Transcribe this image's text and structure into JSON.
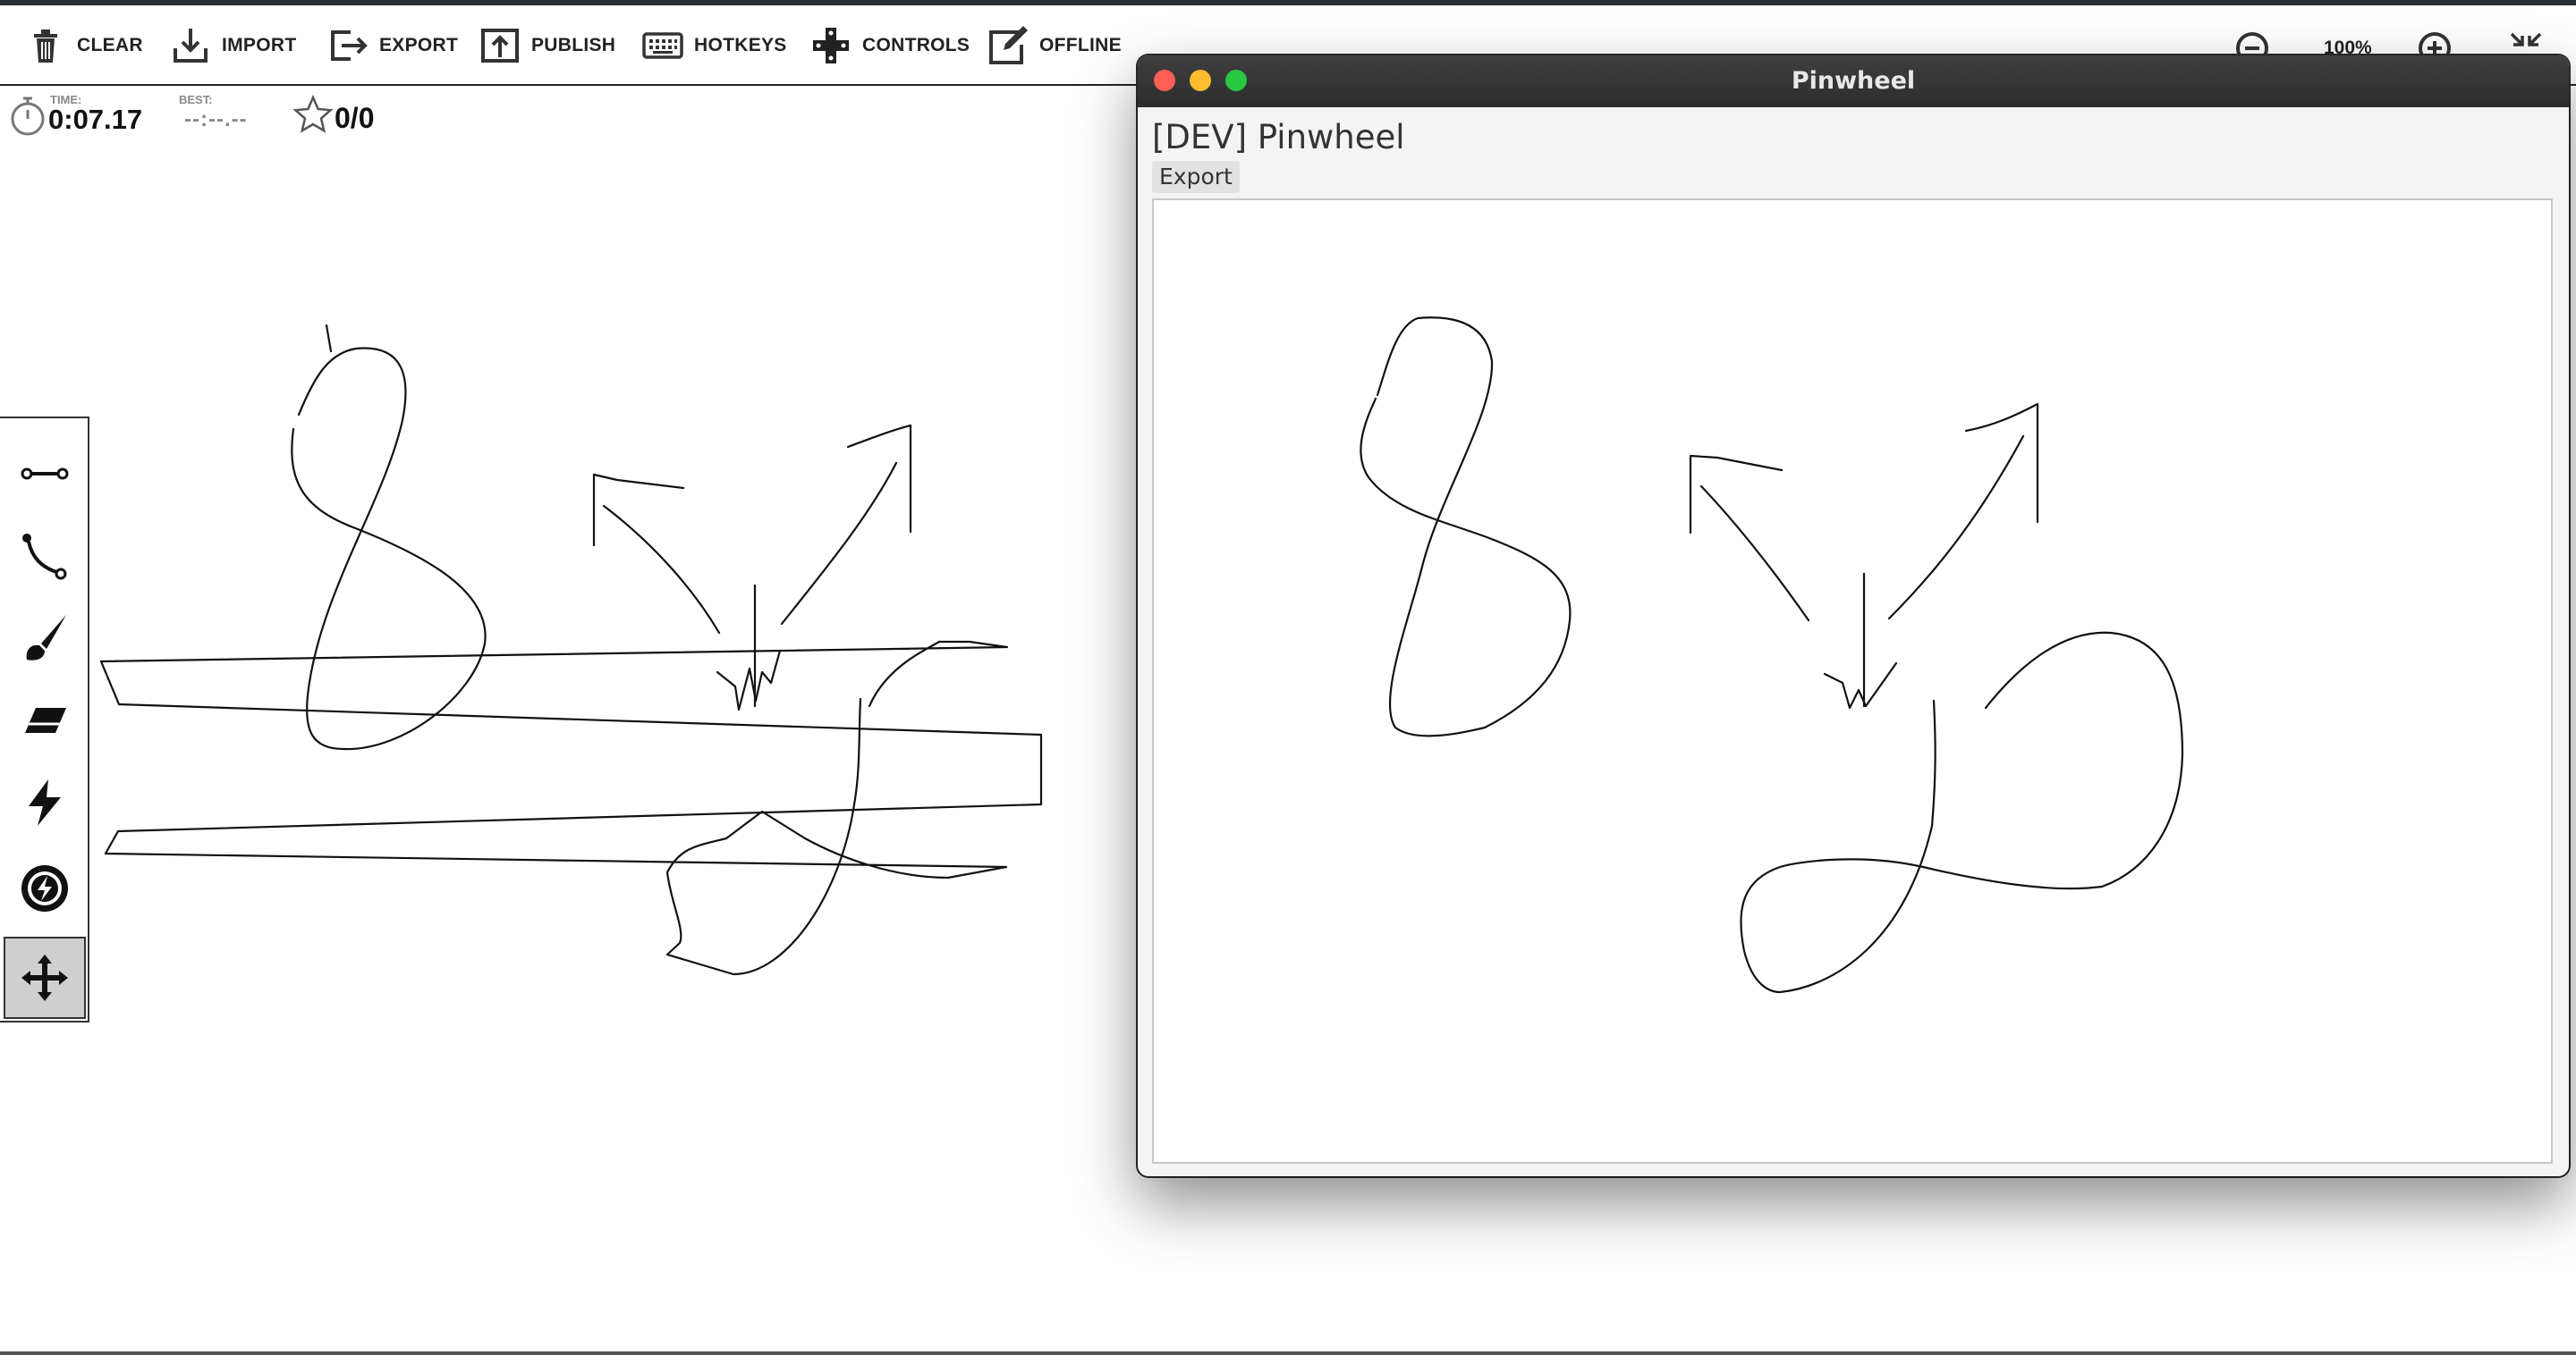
{
  "toolbar": {
    "clear": "CLEAR",
    "import": "IMPORT",
    "export": "EXPORT",
    "publish": "PUBLISH",
    "hotkeys": "HOTKEYS",
    "controls": "CONTROLS",
    "offline": "OFFLINE",
    "zoom": "100%"
  },
  "stats": {
    "time_label": "TIME:",
    "time": "0:07.17",
    "best_label": "BEST:",
    "best": "--:--.--",
    "stars": "0/0"
  },
  "tools": [
    "line-tool",
    "curve-tool",
    "brush-tool",
    "eraser-tool",
    "lightning-tool",
    "power-tool",
    "move-tool"
  ],
  "active_tool": "move-tool",
  "window": {
    "title": "Pinwheel",
    "heading": "[DEV] Pinwheel",
    "export_label": "Export"
  },
  "colors": {
    "ink": "#111111",
    "toolbar_border": "#222222",
    "titlebar": "#333333",
    "close": "#ff5f57",
    "minimize": "#febc2e",
    "maximize": "#28c840"
  }
}
